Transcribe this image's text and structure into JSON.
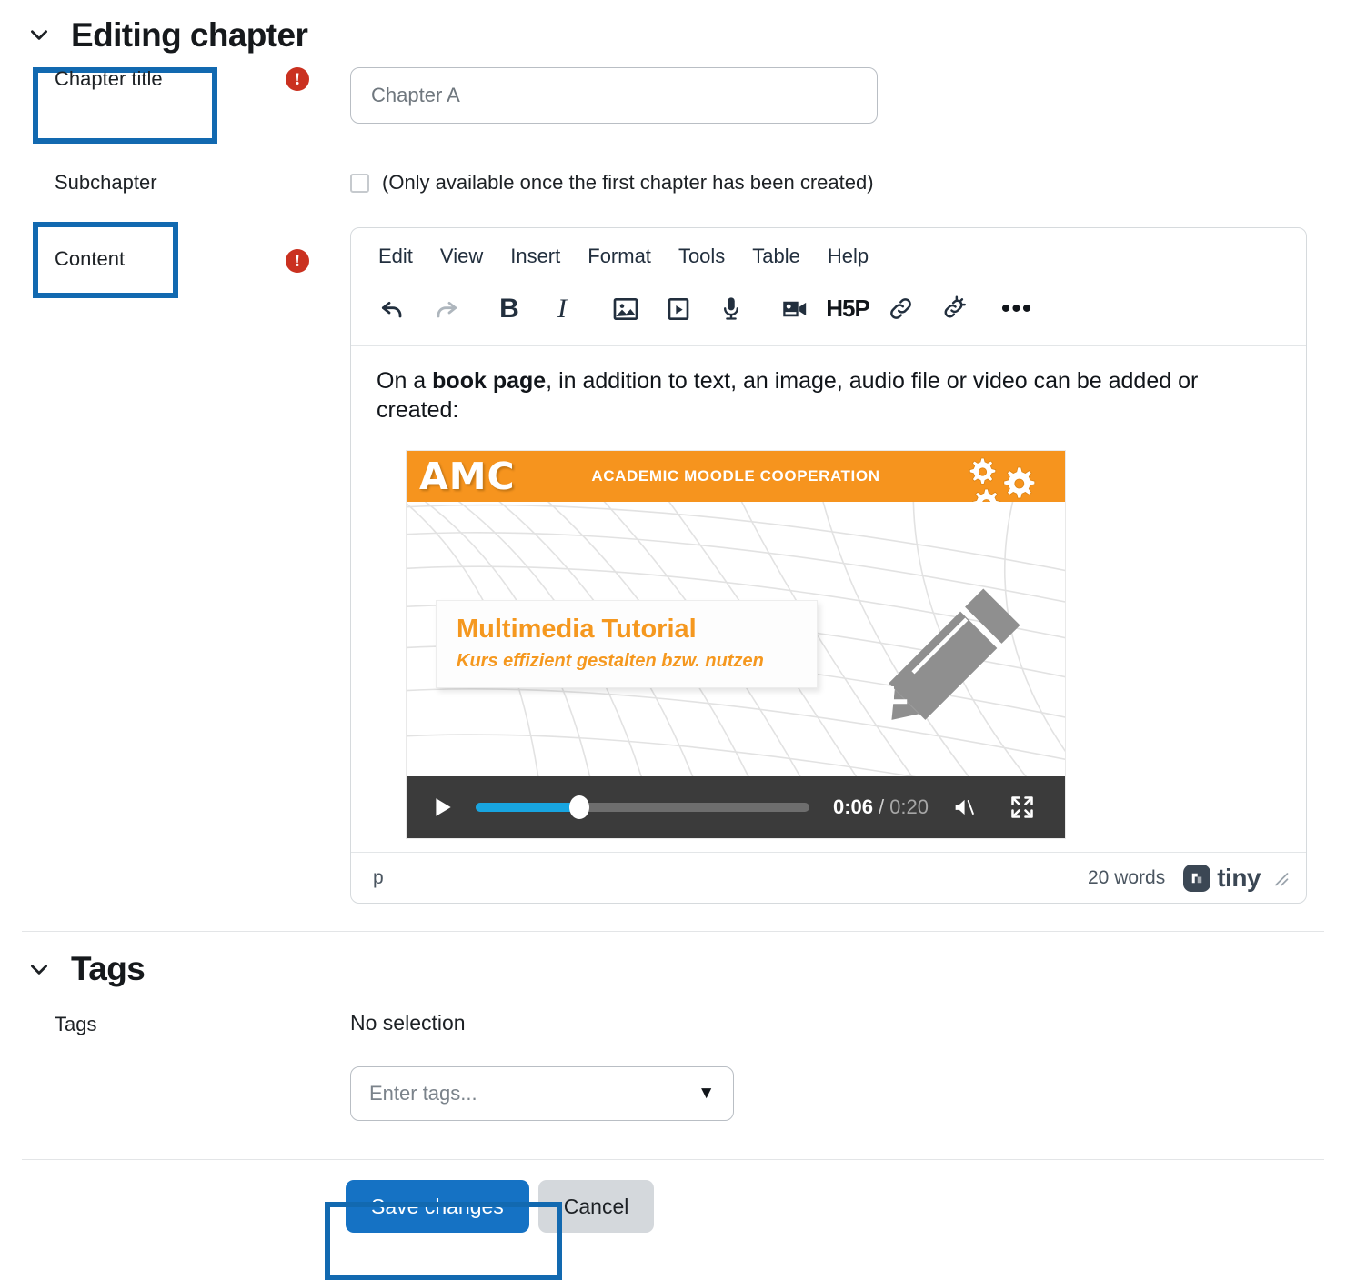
{
  "section": {
    "title": "Editing chapter",
    "collapse_icon": "chevron-down-icon"
  },
  "fields": {
    "chapter_title": {
      "label": "Chapter title",
      "required_icon": "required-exclamation-icon",
      "value": "",
      "placeholder": "Chapter A"
    },
    "subchapter": {
      "label": "Subchapter",
      "checkbox_checked": false,
      "note": "(Only available once the first chapter has been created)"
    },
    "content": {
      "label": "Content",
      "required_icon": "required-exclamation-icon"
    }
  },
  "editor": {
    "menubar": [
      "Edit",
      "View",
      "Insert",
      "Format",
      "Tools",
      "Table",
      "Help"
    ],
    "toolbar": [
      {
        "name": "undo-icon",
        "label": "Undo",
        "disabled": false
      },
      {
        "name": "redo-icon",
        "label": "Redo",
        "disabled": true
      },
      {
        "name": "bold-icon",
        "label": "Bold",
        "glyph": "B"
      },
      {
        "name": "italic-icon",
        "label": "Italic",
        "glyph": "I"
      },
      {
        "name": "image-icon",
        "label": "Insert image"
      },
      {
        "name": "media-icon",
        "label": "Insert media"
      },
      {
        "name": "microphone-icon",
        "label": "Record audio"
      },
      {
        "name": "video-camera-icon",
        "label": "Record video"
      },
      {
        "name": "h5p-icon",
        "label": "H5P",
        "glyph": "H5P"
      },
      {
        "name": "link-icon",
        "label": "Insert link"
      },
      {
        "name": "unlink-icon",
        "label": "Remove link"
      },
      {
        "name": "more-icon",
        "label": "More",
        "glyph": "•••"
      }
    ],
    "body_text_prefix": "On a ",
    "body_text_bold": "book page",
    "body_text_suffix": ", in addition to text, an image, audio file or video can be added or created:",
    "status": {
      "element_path": "p",
      "word_count": "20 words",
      "brand": "tiny"
    }
  },
  "video": {
    "brand": "AMC",
    "tagline": "ACADEMIC MOODLE COOPERATION",
    "caption_title": "Multimedia Tutorial",
    "caption_subtitle": "Kurs effizient gestalten bzw. nutzen",
    "current_time": "0:06",
    "separator": "/",
    "total_time": "0:20",
    "progress_percent": 31,
    "play_icon": "play-icon",
    "mute_icon": "muted-volume-icon",
    "fullscreen_icon": "fullscreen-icon",
    "pencil_icon": "pencil-icon",
    "gears_icon": "gears-icon"
  },
  "tags_section": {
    "title": "Tags",
    "collapse_icon": "chevron-down-icon",
    "label": "Tags",
    "no_selection": "No selection",
    "input_placeholder": "Enter tags...",
    "caret_icon": "caret-down-icon"
  },
  "footer": {
    "save_label": "Save changes",
    "cancel_label": "Cancel"
  },
  "colors": {
    "highlight_blue": "#1269b0",
    "primary_blue": "#1572c4",
    "required_red": "#ca3120",
    "brand_orange": "#f6941e",
    "progress_blue": "#18a5e0",
    "control_bar": "#3b3b3b"
  }
}
